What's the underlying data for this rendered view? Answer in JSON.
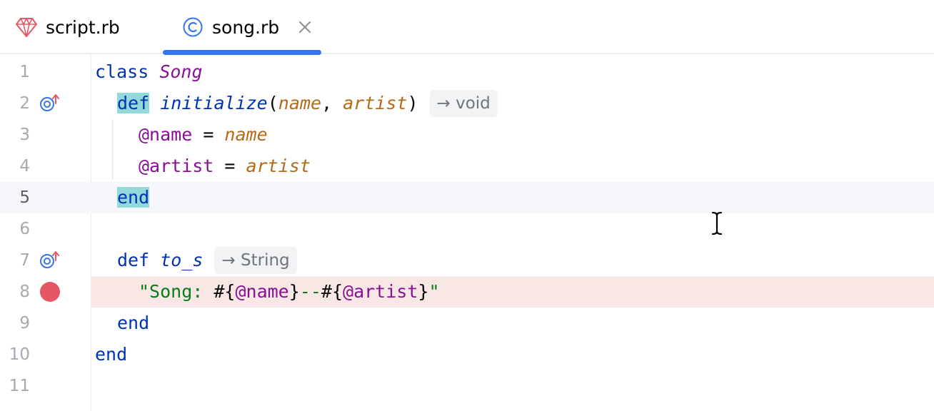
{
  "tabs": [
    {
      "label": "script.rb",
      "icon": "ruby-gem-icon",
      "active": false
    },
    {
      "label": "song.rb",
      "icon": "class-c-icon",
      "active": true,
      "closable": true
    }
  ],
  "colors": {
    "accent": "#3574f0",
    "keyword": "#0033b3",
    "instance_var": "#871094",
    "parameter": "#b36b1a",
    "string": "#067d17",
    "breakpoint": "#e55765",
    "breakpoint_line_bg": "#f9e7e5",
    "brace_match_bg": "#93d9d9"
  },
  "editor": {
    "line_numbers": [
      "1",
      "2",
      "3",
      "4",
      "5",
      "6",
      "7",
      "8",
      "9",
      "10",
      "11"
    ],
    "current_line": 5,
    "breakpoint_line": 8,
    "gutter_icons": [
      {
        "line": 2,
        "icon": "overrides-method-icon"
      },
      {
        "line": 7,
        "icon": "overrides-method-icon"
      },
      {
        "line": 8,
        "icon": "breakpoint-icon"
      }
    ],
    "code": {
      "l1_kw": "class",
      "l1_class": "Song",
      "l2_def": "def",
      "l2_method": "initialize",
      "l2_open": "(",
      "l2_p1": "name",
      "l2_comma": ", ",
      "l2_p2": "artist",
      "l2_close": ")",
      "l2_hint": "→ void",
      "l3_ivar": "@name",
      "l3_eq": " = ",
      "l3_val": "name",
      "l4_ivar": "@artist",
      "l4_eq": " = ",
      "l4_val": "artist",
      "l5_end": "end",
      "l7_def": "def",
      "l7_method": "to_s",
      "l7_hint": "→ String",
      "l8_q1": "\"Song: ",
      "l8_i1o": "#{",
      "l8_v1": "@name",
      "l8_i1c": "}",
      "l8_mid": "--",
      "l8_i2o": "#{",
      "l8_v2": "@artist",
      "l8_i2c": "}",
      "l8_q2": "\"",
      "l9_end": "end",
      "l10_end": "end"
    }
  }
}
